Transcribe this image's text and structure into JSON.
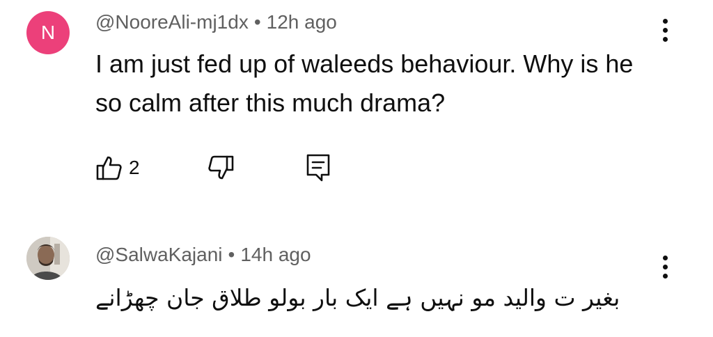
{
  "comments": [
    {
      "avatar_letter": "N",
      "avatar_color": "#ec407a",
      "handle": "@NooreAli-mj1dx",
      "separator": "•",
      "time": "12h ago",
      "text": "I am just fed up of waleeds behaviour. Why is he so calm after this much drama?",
      "likes": "2",
      "icons": [
        "like-icon",
        "dislike-icon",
        "reply-icon",
        "more-options-icon"
      ]
    },
    {
      "avatar": "profile-photo",
      "handle": "@SalwaKajani",
      "separator": "•",
      "time": "14h ago",
      "text": "بغیر ت والید مو نہیں ہے ایک بار بولو طلاق جان چھڑانے",
      "icons": [
        "more-options-icon"
      ]
    }
  ]
}
